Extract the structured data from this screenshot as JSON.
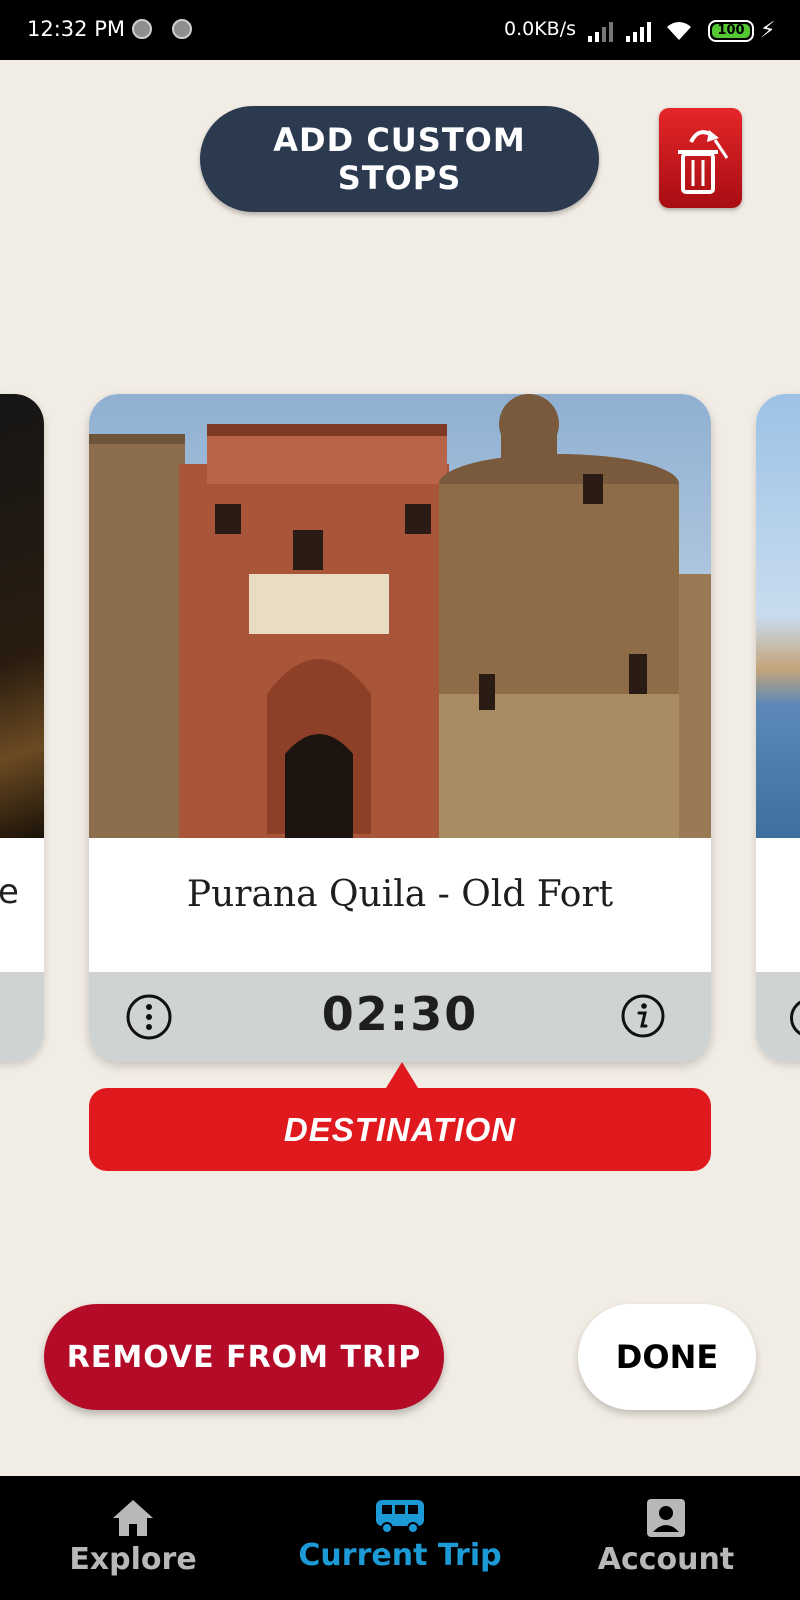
{
  "status_bar": {
    "time": "12:32 PM",
    "network_speed": "0.0KB/s",
    "battery": "100"
  },
  "header": {
    "add_custom_stops_label": "ADD CUSTOM STOPS",
    "delete_icon": "trash-icon"
  },
  "carousel": {
    "left_card_label_fragment": "e",
    "current": {
      "title": "Purana Quila - Old Fort",
      "duration": "02:30",
      "more_icon": "more-vertical-icon",
      "info_icon": "info-icon"
    },
    "badge": "DESTINATION"
  },
  "actions": {
    "remove_label": "REMOVE FROM TRIP",
    "done_label": "DONE"
  },
  "bottom_nav": {
    "items": [
      {
        "label": "Explore",
        "icon": "home-icon",
        "active": false
      },
      {
        "label": "Current Trip",
        "icon": "bus-icon",
        "active": true
      },
      {
        "label": "Account",
        "icon": "account-icon",
        "active": false
      }
    ]
  },
  "colors": {
    "background": "#f1ece4",
    "add_button": "#2b3a4f",
    "destination_badge": "#e0191f",
    "remove_button": "#b40c28",
    "nav_active": "#1b9ad6",
    "nav_inactive": "#b8b8b8"
  }
}
